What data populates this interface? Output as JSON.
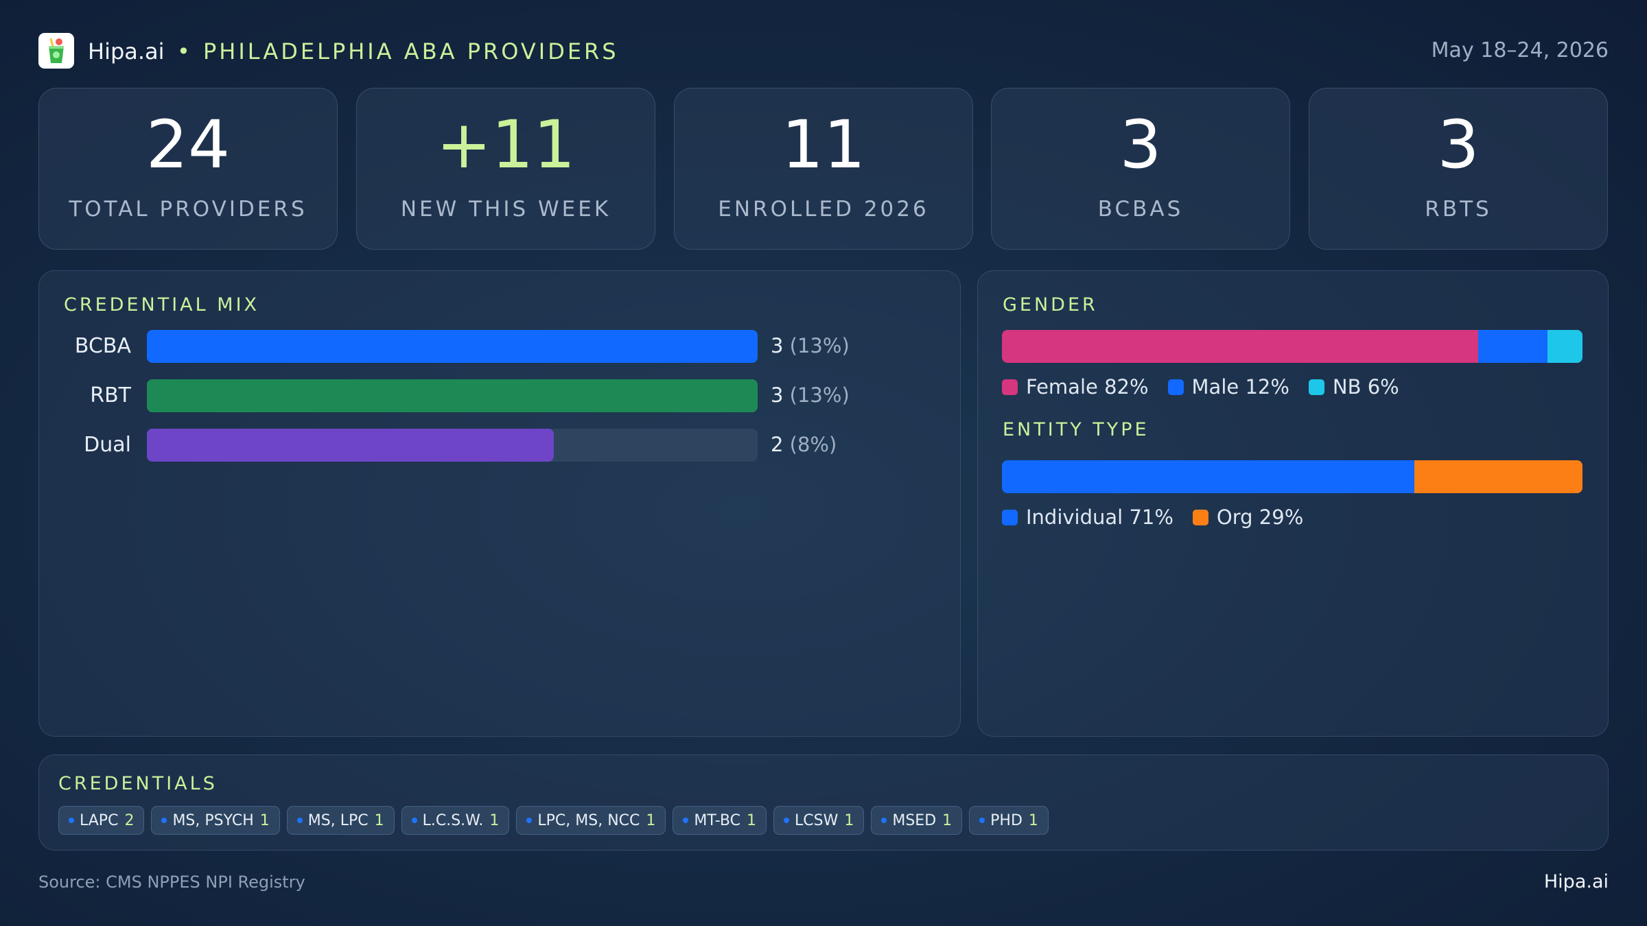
{
  "header": {
    "brand": "Hipa.ai",
    "separator": "•",
    "subtitle": "PHILADELPHIA ABA PROVIDERS",
    "date_range": "May 18–24, 2026"
  },
  "kpis": [
    {
      "value": "24",
      "label": "TOTAL PROVIDERS"
    },
    {
      "value": "+11",
      "label": "NEW THIS WEEK"
    },
    {
      "value": "11",
      "label": "ENROLLED 2026"
    },
    {
      "value": "3",
      "label": "BCBAS"
    },
    {
      "value": "3",
      "label": "RBTS"
    }
  ],
  "chart_data": [
    {
      "type": "bar",
      "title": "CREDENTIAL MIX",
      "categories": [
        "BCBA",
        "RBT",
        "Dual"
      ],
      "values": [
        3,
        3,
        2
      ],
      "value_labels": [
        "3",
        "3",
        "2"
      ],
      "pct_labels": [
        "(13%)",
        "(13%)",
        "(8%)"
      ],
      "xlim": [
        0,
        3
      ],
      "colors": [
        "#1169ff",
        "#1d8a55",
        "#6f45c8"
      ]
    },
    {
      "type": "bar",
      "stacked": true,
      "title": "GENDER",
      "series": [
        {
          "name": "Female 82%",
          "value": 82,
          "color": "#d6357f"
        },
        {
          "name": "Male 12%",
          "value": 12,
          "color": "#1169ff"
        },
        {
          "name": "NB 6%",
          "value": 6,
          "color": "#1ec6ea"
        }
      ]
    },
    {
      "type": "bar",
      "stacked": true,
      "title": "ENTITY TYPE",
      "series": [
        {
          "name": "Individual 71%",
          "value": 71,
          "color": "#1169ff"
        },
        {
          "name": "Org 29%",
          "value": 29,
          "color": "#fb7f15"
        }
      ]
    }
  ],
  "credentials": {
    "title": "CREDENTIALS",
    "chips": [
      {
        "label": "LAPC",
        "count": "2"
      },
      {
        "label": "MS, PSYCH",
        "count": "1"
      },
      {
        "label": "MS, LPC",
        "count": "1"
      },
      {
        "label": "L.C.S.W.",
        "count": "1"
      },
      {
        "label": "LPC, MS, NCC",
        "count": "1"
      },
      {
        "label": "MT-BC",
        "count": "1"
      },
      {
        "label": "LCSW",
        "count": "1"
      },
      {
        "label": "MSED",
        "count": "1"
      },
      {
        "label": "PHD",
        "count": "1"
      }
    ]
  },
  "footer": {
    "source": "Source: CMS NPPES NPI Registry",
    "brand": "Hipa.ai"
  }
}
